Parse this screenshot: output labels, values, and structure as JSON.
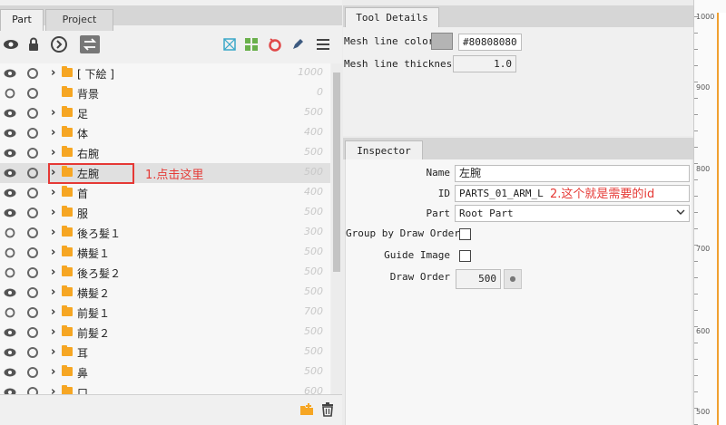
{
  "left_panel": {
    "tabs": [
      "Part",
      "Project"
    ],
    "layers": [
      {
        "name": "[ 下絵 ]",
        "order": "1000",
        "visible": true,
        "expandable": true
      },
      {
        "name": "背景",
        "order": "0",
        "visible": false,
        "expandable": false
      },
      {
        "name": "足",
        "order": "500",
        "visible": true,
        "expandable": true
      },
      {
        "name": "体",
        "order": "400",
        "visible": true,
        "expandable": true
      },
      {
        "name": "右腕",
        "order": "500",
        "visible": true,
        "expandable": true
      },
      {
        "name": "左腕",
        "order": "500",
        "visible": true,
        "expandable": true,
        "selected": true
      },
      {
        "name": "首",
        "order": "400",
        "visible": true,
        "expandable": true
      },
      {
        "name": "服",
        "order": "500",
        "visible": true,
        "expandable": true
      },
      {
        "name": "後ろ髪１",
        "order": "300",
        "visible": false,
        "expandable": true
      },
      {
        "name": "横髪１",
        "order": "500",
        "visible": false,
        "expandable": true
      },
      {
        "name": "後ろ髪２",
        "order": "500",
        "visible": false,
        "expandable": true
      },
      {
        "name": "横髪２",
        "order": "500",
        "visible": true,
        "expandable": true
      },
      {
        "name": "前髪１",
        "order": "700",
        "visible": false,
        "expandable": true
      },
      {
        "name": "前髪２",
        "order": "500",
        "visible": true,
        "expandable": true
      },
      {
        "name": "耳",
        "order": "500",
        "visible": true,
        "expandable": true
      },
      {
        "name": "鼻",
        "order": "500",
        "visible": true,
        "expandable": true
      },
      {
        "name": "口",
        "order": "600",
        "visible": true,
        "expandable": true
      }
    ]
  },
  "annotations": {
    "click_here": "1.点击这里",
    "id_needed": "2.这个就是需要的id"
  },
  "tool_details": {
    "tab": "Tool Details",
    "mesh_line_color_label": "Mesh line color",
    "mesh_line_color_value": "#80808080",
    "mesh_line_color_swatch": "#b4b4b4",
    "mesh_line_thickness_label": "Mesh line thickness",
    "mesh_line_thickness_value": "1.0"
  },
  "inspector": {
    "tab": "Inspector",
    "name_label": "Name",
    "name_value": "左腕",
    "id_label": "ID",
    "id_value": "PARTS_01_ARM_L",
    "part_label": "Part",
    "part_value": "Root Part",
    "group_label": "Group by Draw Order",
    "guide_label": "Guide Image",
    "draw_order_label": "Draw Order",
    "draw_order_value": "500"
  },
  "ruler": {
    "labels": [
      "1000",
      "900",
      "800",
      "700",
      "600",
      "500"
    ]
  },
  "colors": {
    "accent_red": "#e53935",
    "folder": "#f6a623"
  }
}
